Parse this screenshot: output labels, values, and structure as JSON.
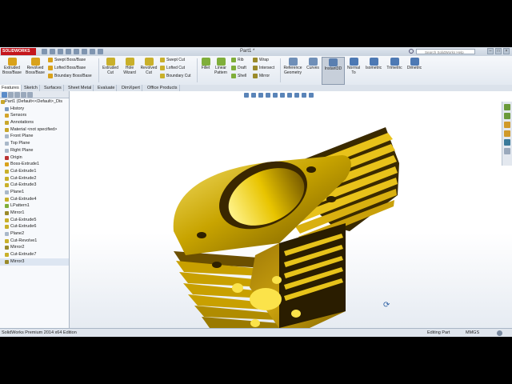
{
  "app": {
    "logo": "SOLIDWORKS",
    "document_title": "Part1 *",
    "search_placeholder": "Search SolidWorks Help"
  },
  "ribbon": {
    "extruded_boss": "Extruded Boss/Base",
    "revolved_boss": "Revolved Boss/Base",
    "swept_boss": "Swept Boss/Base",
    "lofted_boss": "Lofted Boss/Base",
    "boundary_boss": "Boundary Boss/Base",
    "extruded_cut": "Extruded Cut",
    "hole_wizard": "Hole Wizard",
    "revolved_cut": "Revolved Cut",
    "swept_cut": "Swept Cut",
    "lofted_cut": "Lofted Cut",
    "boundary_cut": "Boundary Cut",
    "fillet": "Fillet",
    "linear_pattern": "Linear Pattern",
    "rib": "Rib",
    "draft": "Draft",
    "shell": "Shell",
    "wrap": "Wrap",
    "intersect": "Intersect",
    "mirror": "Mirror",
    "reference_geometry": "Reference Geometry",
    "curves": "Curves",
    "instant3d": "Instant3D",
    "normal_to": "Normal To",
    "isometric": "Isometric",
    "trimetric": "Trimetric",
    "dimetric": "Dimetric"
  },
  "command_tabs": [
    "Features",
    "Sketch",
    "Surfaces",
    "Sheet Metal",
    "Evaluate",
    "DimXpert",
    "Office Products"
  ],
  "tree": [
    "Part1  (Default<<Default>_Dis",
    "History",
    "Sensors",
    "Annotations",
    "Material <not specified>",
    "Front Plane",
    "Top Plane",
    "Right Plane",
    "Origin",
    "Boss-Extrude1",
    "Cut-Extrude1",
    "Cut-Extrude2",
    "Cut-Extrude3",
    "Plane1",
    "Cut-Extrude4",
    "LPattern1",
    "Mirror1",
    "Cut-Extrude5",
    "Cut-Extrude6",
    "Plane2",
    "Cut-Revolve1",
    "Mirror2",
    "Cut-Extrude7",
    "Mirror3"
  ],
  "status": {
    "edition": "SolidWorks Premium 2014 x64 Edition",
    "mode": "Editing Part",
    "units": "MMGS"
  },
  "colors": {
    "part_gold": "#c8a400",
    "part_dark": "#3a2a00",
    "accent_blue": "#2c5fa3",
    "logo_red": "#c4161c"
  }
}
